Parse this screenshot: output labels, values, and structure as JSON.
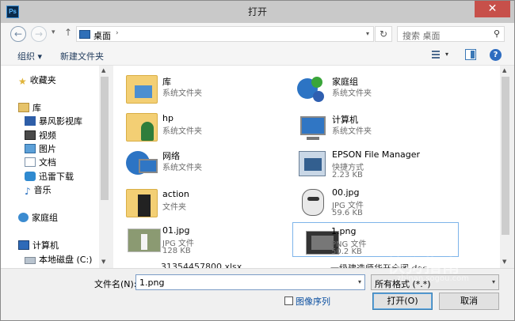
{
  "window": {
    "title": "打开",
    "app_icon": "Ps",
    "close_glyph": "✕"
  },
  "nav": {
    "back_glyph": "←",
    "forward_glyph": "→",
    "history_glyph": "▾",
    "up_glyph": "↑"
  },
  "address": {
    "location": "桌面",
    "chevron": "›",
    "dropdown": "▾",
    "refresh_glyph": "↻"
  },
  "search": {
    "placeholder": "搜索 桌面",
    "icon": "⚲"
  },
  "toolbar": {
    "organize_label": "组织 ▾",
    "new_folder_label": "新建文件夹",
    "view_drop": "▾",
    "help": "?"
  },
  "sidebar": {
    "items": [
      {
        "label": "收藏夹",
        "icon": "star-icon"
      },
      {
        "label": "库",
        "icon": "library-icon"
      },
      {
        "label": "暴风影视库",
        "icon": "video-library-icon"
      },
      {
        "label": "视频",
        "icon": "video-icon"
      },
      {
        "label": "图片",
        "icon": "pictures-icon"
      },
      {
        "label": "文档",
        "icon": "documents-icon"
      },
      {
        "label": "迅雷下载",
        "icon": "download-icon"
      },
      {
        "label": "音乐",
        "icon": "music-icon"
      },
      {
        "label": "家庭组",
        "icon": "homegroup-icon"
      },
      {
        "label": "计算机",
        "icon": "computer-icon"
      },
      {
        "label": "本地磁盘 (C:)",
        "icon": "disk-icon"
      }
    ]
  },
  "files": [
    {
      "name": "库",
      "type": "系统文件夹",
      "size": ""
    },
    {
      "name": "家庭组",
      "type": "系统文件夹",
      "size": ""
    },
    {
      "name": "hp",
      "type": "系统文件夹",
      "size": ""
    },
    {
      "name": "计算机",
      "type": "系统文件夹",
      "size": ""
    },
    {
      "name": "网络",
      "type": "系统文件夹",
      "size": ""
    },
    {
      "name": "EPSON File Manager",
      "type": "快捷方式",
      "size": "2.23 KB"
    },
    {
      "name": "action",
      "type": "文件夹",
      "size": ""
    },
    {
      "name": "00.jpg",
      "type": "JPG 文件",
      "size": "59.6 KB"
    },
    {
      "name": "01.jpg",
      "type": "JPG 文件",
      "size": "128 KB"
    },
    {
      "name": "1.png",
      "type": "PNG 文件",
      "size": "50.2 KB"
    }
  ],
  "partial_rows": [
    "31354457800.xlsx",
    "一级建造师华开全图.doc"
  ],
  "footer": {
    "filename_label": "文件名(N):",
    "filename_value": "1.png",
    "filetype_value": "所有格式 (*.*)",
    "sequence_label": "图像序列",
    "open_label": "打开(O)",
    "cancel_label": "取消",
    "dropdown": "▾"
  },
  "watermark": {
    "main": "快狗指南",
    "sub": "zhinan.sogou.com"
  }
}
